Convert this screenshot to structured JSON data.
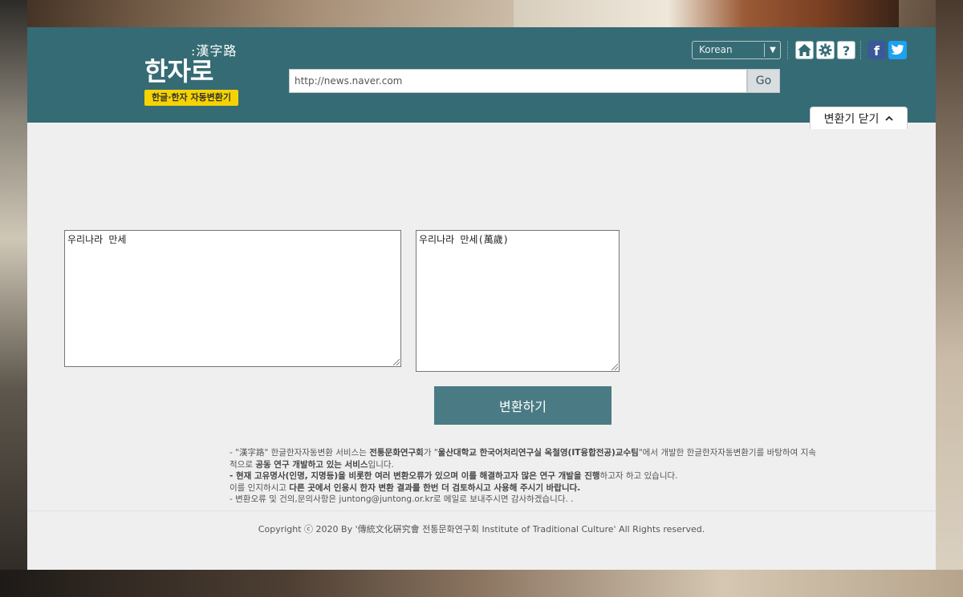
{
  "header": {
    "logo_hanja": ":漢字路",
    "logo_main": "한자로",
    "logo_badge": "한글·한자 자동변환기",
    "url_value": "http://news.naver.com",
    "go_label": "Go",
    "language": "Korean",
    "close_tab_label": "변환기 닫기",
    "colors": {
      "header_bg": "#356b74",
      "badge": "#f6d300"
    }
  },
  "converter": {
    "input_text": "우리나라 만세",
    "output_text": "우리나라 만세(萬歲)",
    "convert_label": "변환하기"
  },
  "notice": {
    "line1_prefix": "- \"漢字路\" 한글한자자동변환 서비스는 ",
    "line1_org": "전통문화연구회",
    "line1_mid": "가 \"",
    "line1_lab": "울산대학교 한국어처리연구실 옥철영(IT융합전공)교수팀",
    "line1_suffix": "\"에서 개발한 한글한자자동변환기를 바탕하여 지속적으로 ",
    "line1_bold_end": "공동 연구 개발하고 있는 서비스",
    "line1_end": "입니다.",
    "line2_bold": "- 현재 고유명사(인명, 지명등)을 비롯한 여러 변환오류가 있으며 이를 해결하고자 많은 연구 개발을 진행",
    "line2_end": "하고자 하고 있습니다.",
    "line3_prefix": "이를 인지하시고 ",
    "line3_bold": "다른 곳에서 인용시 한자 변환 결과를 한번 더 검토하시고 사용해 주시기 바랍니다.",
    "line4": "- 변환오류 및 건의,문의사항은 juntong@juntong.or.kr로 메일로 보내주시면 감사하겠습니다. ."
  },
  "footer": {
    "copyright": "Copyright ⓒ 2020 By '傳統文化硏究會 전통문화연구회 Institute of Traditional Culture' All Rights reserved."
  }
}
